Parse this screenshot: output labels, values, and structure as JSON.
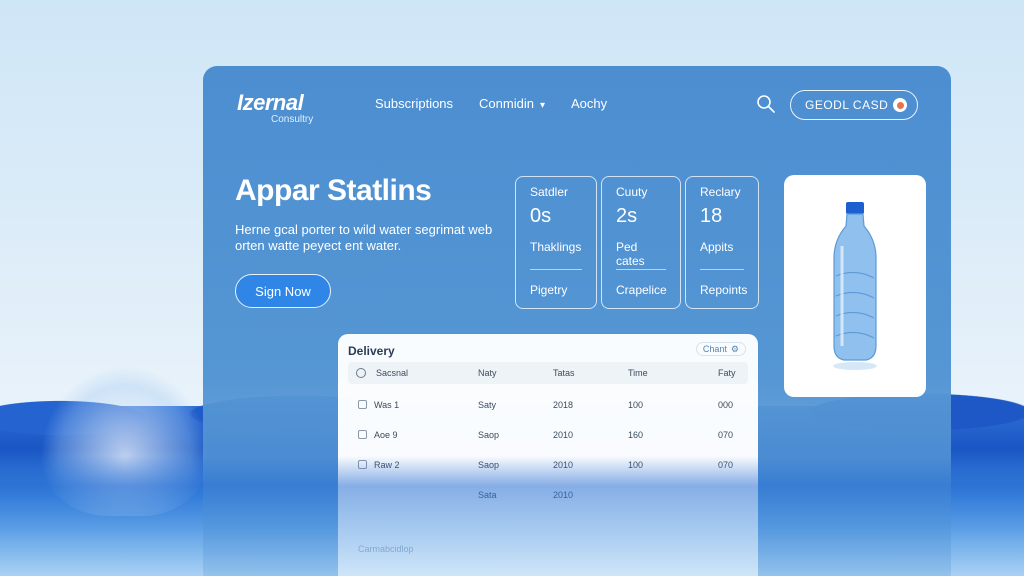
{
  "header": {
    "logo_main": "Izernal",
    "logo_sub": "Consultry",
    "nav": [
      {
        "label": "Subscriptions",
        "dropdown": false
      },
      {
        "label": "Conmidin",
        "dropdown": true
      },
      {
        "label": "Aochy",
        "dropdown": false
      }
    ],
    "cta_label": "GEODL CASD"
  },
  "hero": {
    "title": "Appar Statlins",
    "subtitle": "Herne gcal porter to wild water segrimat web orten watte peyect ent water.",
    "sign_in_label": "Sign Now"
  },
  "stats": [
    {
      "label": "Satdler",
      "value": "0s",
      "mid": "Thaklings",
      "foot": "Pigetry"
    },
    {
      "label": "Cuuty",
      "value": "2s",
      "mid": "Ped cates",
      "foot": "Crapelice"
    },
    {
      "label": "Reclary",
      "value": "18",
      "mid": "Appits",
      "foot": "Repoints"
    }
  ],
  "delivery": {
    "title": "Delivery",
    "chip_label": "Chant",
    "columns": [
      "Sacsnal",
      "Naty",
      "Tatas",
      "Time",
      "Faty"
    ],
    "rows": [
      [
        "Was 1",
        "Saty",
        "2018",
        "100",
        "000"
      ],
      [
        "Aoe 9",
        "Saop",
        "2010",
        "160",
        "070"
      ],
      [
        "Raw 2",
        "Saop",
        "2010",
        "100",
        "070"
      ],
      [
        "",
        "Sata",
        "2010",
        "",
        ""
      ]
    ],
    "footer": "Carmabcidlop"
  },
  "colors": {
    "panel": "#5596d4",
    "accent": "#2f86e6",
    "cta_dot": "#e8744a"
  },
  "icons": {
    "search": "search-icon",
    "chevron": "chevron-down-icon",
    "bottle": "water-bottle-image"
  }
}
